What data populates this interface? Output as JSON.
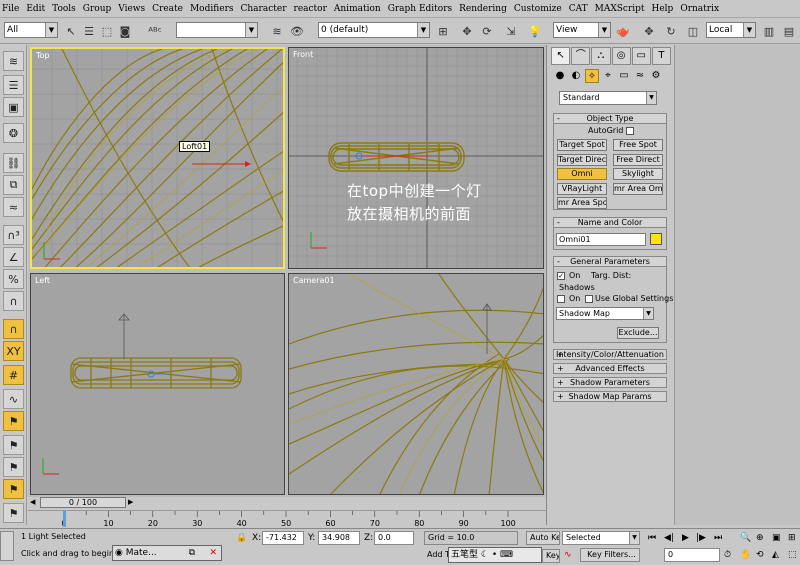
{
  "menu": [
    "File",
    "Edit",
    "Tools",
    "Group",
    "Views",
    "Create",
    "Modifiers",
    "Character",
    "reactor",
    "Animation",
    "Graph Editors",
    "Rendering",
    "Customize",
    "CAT",
    "MAXScript",
    "Help",
    "Ornatrix"
  ],
  "toolbar": {
    "selection_filter": "All",
    "layer": "0 (default)",
    "coord_system": "View",
    "pivot": "Local"
  },
  "viewports": {
    "top": "Top",
    "front": "Front",
    "left": "Left",
    "camera": "Camera01"
  },
  "tooltip": "Loft01",
  "overlay": {
    "line1": "在top中创建一个灯",
    "line2": "放在摄相机的前面"
  },
  "command_panel": {
    "category": "Standard",
    "object_type": {
      "title": "Object Type",
      "autogrid": "AutoGrid",
      "buttons": [
        "Target Spot",
        "Free Spot",
        "Target Direct",
        "Free Direct",
        "Omni",
        "Skylight",
        "VRayLight",
        "mr Area Omni",
        "mr Area Spot"
      ]
    },
    "name_color": {
      "title": "Name and Color",
      "name": "Omni01"
    },
    "general": {
      "title": "General Parameters",
      "on": "On",
      "targ_dist": "Targ. Dist:",
      "shadows": "Shadows",
      "shadows_on": "On",
      "use_global": "Use Global Settings",
      "shadow_type": "Shadow Map",
      "exclude": "Exclude..."
    },
    "collapsed": [
      "Intensity/Color/Attenuation",
      "Advanced Effects",
      "Shadow Parameters",
      "Shadow Map Params"
    ]
  },
  "timeline": {
    "slider": "0 / 100",
    "ticks": [
      "0",
      "10",
      "20",
      "30",
      "40",
      "50",
      "60",
      "70",
      "80",
      "90",
      "100"
    ]
  },
  "status": {
    "selection": "1 Light Selected",
    "prompt": "Click and drag to begin cre",
    "task": "Mate...",
    "x_label": "X:",
    "x": "-71.432",
    "y_label": "Y:",
    "y": "34.908",
    "z_label": "Z:",
    "z": "0.0",
    "grid": "Grid = 10.0",
    "autokey": "Auto Key",
    "setkey": "Key",
    "selected": "Selected",
    "keyfilters": "Key Filters...",
    "frame": "0",
    "add_time": "Add T",
    "ime": "五笔型"
  },
  "colors": {
    "wire": "#8b7a10",
    "active_border": "#f3e64a",
    "viewport_bg": "#a3a3a3",
    "yellow_btn": "#f0c040"
  }
}
